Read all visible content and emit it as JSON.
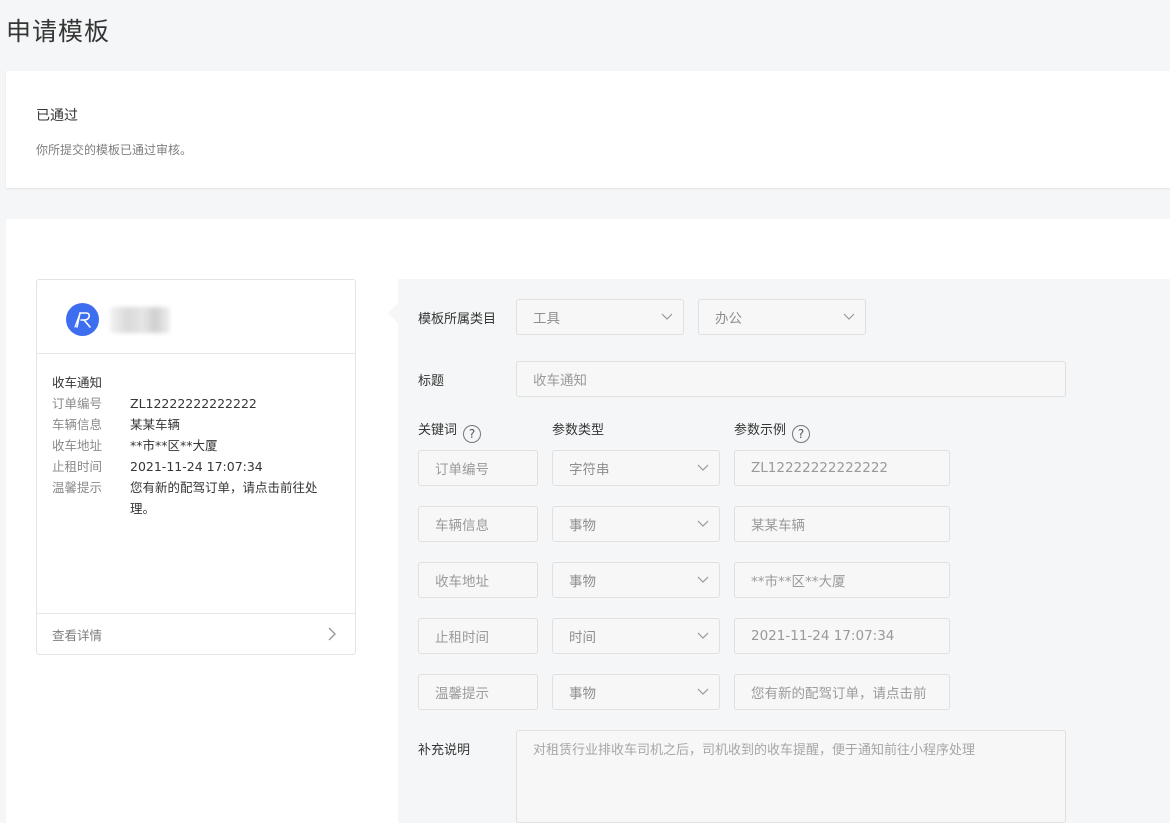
{
  "page_title": "申请模板",
  "status": {
    "title": "已通过",
    "desc": "你所提交的模板已通过审核。"
  },
  "preview": {
    "title": "收车通知",
    "rows": [
      {
        "label": "订单编号",
        "value": "ZL12222222222222"
      },
      {
        "label": "车辆信息",
        "value": "某某车辆"
      },
      {
        "label": "收车地址",
        "value": "**市**区**大厦"
      },
      {
        "label": "止租时间",
        "value": "2021-11-24 17:07:34"
      },
      {
        "label": "温馨提示",
        "value": "您有新的配驾订单，请点击前往处理。"
      }
    ],
    "detail_label": "查看详情"
  },
  "form": {
    "category_label": "模板所属类目",
    "category_primary": "工具",
    "category_secondary": "办公",
    "title_label": "标题",
    "title_value": "收车通知",
    "keyword_header": "关键词",
    "param_type_header": "参数类型",
    "param_example_header": "参数示例",
    "help_glyph": "?",
    "rows": [
      {
        "keyword": "订单编号",
        "type": "字符串",
        "example": "ZL12222222222222"
      },
      {
        "keyword": "车辆信息",
        "type": "事物",
        "example": "某某车辆"
      },
      {
        "keyword": "收车地址",
        "type": "事物",
        "example": "**市**区**大厦"
      },
      {
        "keyword": "止租时间",
        "type": "时间",
        "example": "2021-11-24 17:07:34"
      },
      {
        "keyword": "温馨提示",
        "type": "事物",
        "example": "您有新的配驾订单，请点击前"
      }
    ],
    "supplement_label": "补充说明",
    "supplement_value": "对租赁行业排收车司机之后，司机收到的收车提醒，便于通知前往小程序处理"
  },
  "icons": {
    "avatar": "brand-logo-icon",
    "detail_arrow": "chevron-right-icon",
    "select_arrow": "chevron-down-icon",
    "help": "question-circle-icon"
  },
  "colors": {
    "brand_blue": "#3d6ef0",
    "background": "#f5f6f7"
  }
}
